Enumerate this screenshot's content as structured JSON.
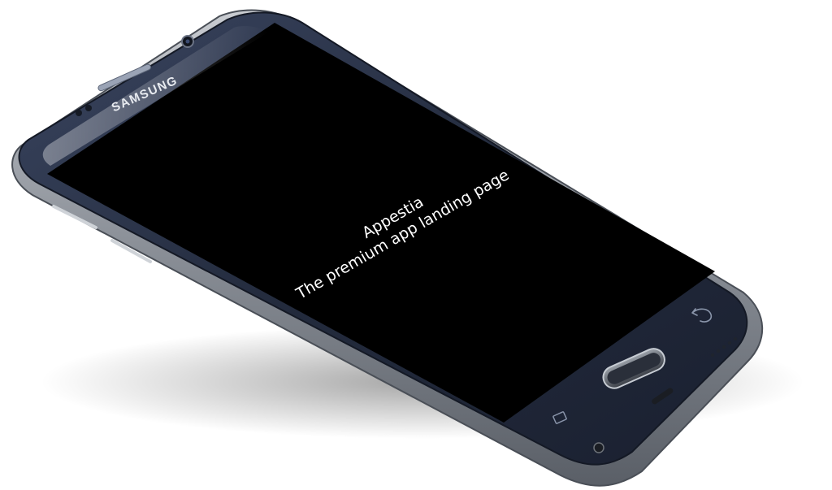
{
  "device": {
    "brand": "SAMSUNG",
    "body_color": "#2b3346",
    "frame_color": "#8e939b",
    "screen_color": "#000000"
  },
  "screen": {
    "app_name": "Appestia",
    "tagline": "The premium app landing page",
    "text_color": "#ffffff"
  },
  "icons": {
    "back": "back-arrow-icon",
    "recent_apps": "recent-apps-icon",
    "home": "home-button",
    "camera": "front-camera-icon",
    "speaker": "earpiece-speaker-icon"
  }
}
